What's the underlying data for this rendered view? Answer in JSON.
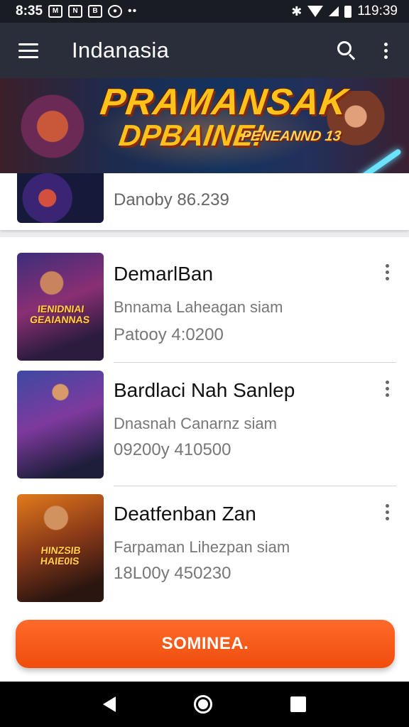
{
  "status_bar": {
    "time": "8:35",
    "app_icon_1": "M",
    "app_icon_2": "N",
    "app_icon_3": "B",
    "app_icon_4": "●",
    "overflow": "••",
    "clock_right": "119:39",
    "icons": [
      "bluetooth-icon",
      "wifi-icon",
      "signal-icon",
      "battery-icon"
    ]
  },
  "app_bar": {
    "title": "Indanasia"
  },
  "banner": {
    "headline_1": "PRAMANSAK",
    "headline_2": "DPBAINE!",
    "headline_3": "PENEANND 13"
  },
  "partial_item": {
    "meta": "Danoby  86.239"
  },
  "items": [
    {
      "title": "DemarlBan",
      "subtitle": "Bnnama Laheagan siam",
      "meta": "Patooy  4:0200",
      "thumb_caption": "IENIDNIAI GEAIANNAS"
    },
    {
      "title": "Bardlaci Nah Sanlep",
      "subtitle": "Dnasnah Canarnz siam",
      "meta": "09200y  410500",
      "thumb_caption": ""
    },
    {
      "title": "Deatfenban Zan",
      "subtitle": "Farpaman Lihezpan siam",
      "meta": "18L00y  450230",
      "thumb_caption": "HINZSIB HAIE0IS"
    }
  ],
  "cta": {
    "label": "SOMINEA."
  },
  "colors": {
    "app_bar": "#2a2d3a",
    "accent": "#f04d0c",
    "banner_text": "#ffc21a"
  }
}
